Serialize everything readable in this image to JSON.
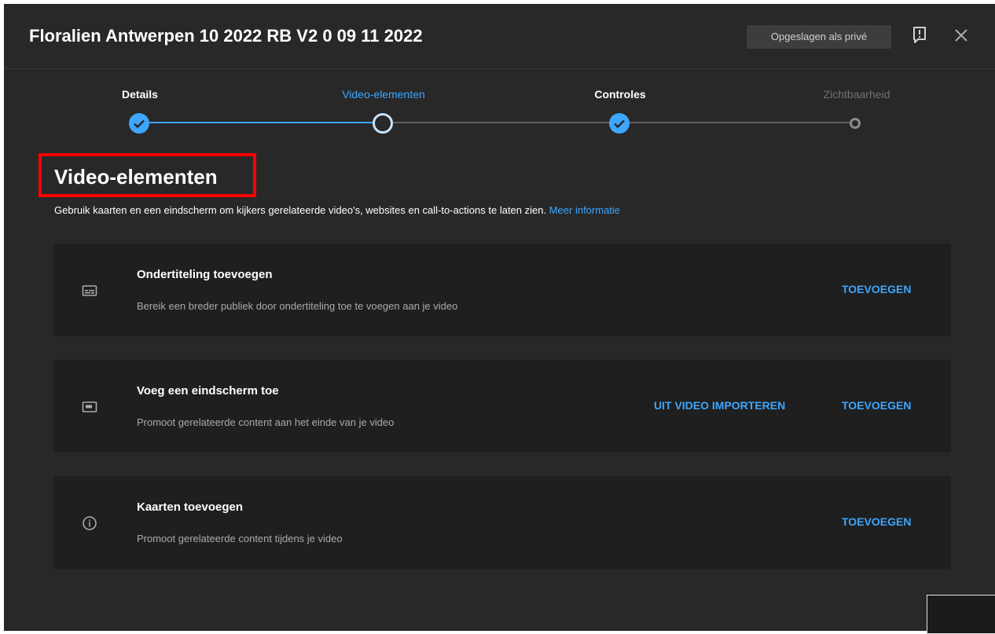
{
  "header": {
    "title": "Floralien Antwerpen 10 2022 RB V2 0 09 11 2022",
    "saved_badge": "Opgeslagen als privé",
    "feedback_icon": "feedback-flag-icon",
    "close_icon": "close-icon"
  },
  "stepper": {
    "steps": [
      {
        "label": "Details",
        "state": "done"
      },
      {
        "label": "Video-elementen",
        "state": "current"
      },
      {
        "label": "Controles",
        "state": "done"
      },
      {
        "label": "Zichtbaarheid",
        "state": "future"
      }
    ]
  },
  "section": {
    "title": "Video-elementen",
    "description": "Gebruik kaarten en een eindscherm om kijkers gerelateerde video's, websites en call-to-actions te laten zien.",
    "link": "Meer informatie"
  },
  "cards": [
    {
      "icon": "subtitles-icon",
      "title": "Ondertiteling toevoegen",
      "description": "Bereik een breder publiek door ondertiteling toe te voegen aan je video",
      "action": "TOEVOEGEN"
    },
    {
      "icon": "end-screen-icon",
      "title": "Voeg een eindscherm toe",
      "description": "Promoot gerelateerde content aan het einde van je video",
      "secondary_action": "UIT VIDEO IMPORTEREN",
      "action": "TOEVOEGEN"
    },
    {
      "icon": "info-icon",
      "title": "Kaarten toevoegen",
      "description": "Promoot gerelateerde content tijdens je video",
      "action": "TOEVOEGEN"
    }
  ],
  "colors": {
    "dialog_bg": "#282828",
    "card_bg": "#1f1f1f",
    "accent": "#3ea6ff",
    "highlight": "#ff0000"
  }
}
